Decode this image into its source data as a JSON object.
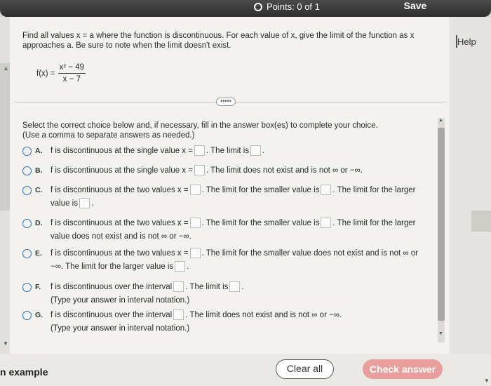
{
  "header": {
    "points_label": "Points: 0 of 1",
    "save_label": "Save"
  },
  "help_label": "Help",
  "question": {
    "text": "Find all values x = a where the function is discontinuous. For each value of x, give the limit of the function as x approaches a. Be sure to note when the limit doesn't exist.",
    "fx_label": "f(x) =",
    "numerator": "x² − 49",
    "denominator": "x − 7"
  },
  "expand_label": "•••••",
  "instructions": {
    "line1": "Select the correct choice below and, if necessary, fill in the answer box(es) to complete your choice.",
    "line2": "(Use a comma to separate answers as needed.)"
  },
  "choices": {
    "a": {
      "letter": "A.",
      "t1": "f is discontinuous at the single value x =",
      "t2": ". The limit is",
      "t3": "."
    },
    "b": {
      "letter": "B.",
      "t1": "f is discontinuous at the single value x =",
      "t2": ". The limit does not exist and is not ∞ or −∞."
    },
    "c": {
      "letter": "C.",
      "t1": "f is discontinuous at the two values x =",
      "t2": ". The limit for the smaller value is",
      "t3": ". The limit for the larger",
      "t4": "value is",
      "t5": "."
    },
    "d": {
      "letter": "D.",
      "t1": "f is discontinuous at the two values x =",
      "t2": ". The limit for the smaller value is",
      "t3": ". The limit for the larger",
      "t4": "value does not exist and is not ∞ or −∞."
    },
    "e": {
      "letter": "E.",
      "t1": "f is discontinuous at the two values x =",
      "t2": ". The limit for the smaller value does not exist and is not ∞ or",
      "t3": "−∞. The limit for the larger value is",
      "t4": "."
    },
    "f": {
      "letter": "F.",
      "t1": "f is discontinuous over the interval",
      "t2": ". The limit is",
      "t3": ".",
      "t4": "(Type your answer in interval notation.)"
    },
    "g": {
      "letter": "G.",
      "t1": "f is discontinuous over the interval",
      "t2": ". The limit does not exist and is not ∞ or −∞.",
      "t3": "(Type your answer in interval notation.)"
    }
  },
  "footer": {
    "example_label": "n example",
    "clear_label": "Clear all",
    "check_label": "Check answer"
  },
  "colors": {
    "radio": "#2f6fb3",
    "check_button": "#e79e9c",
    "header": "#3a3a3a"
  }
}
